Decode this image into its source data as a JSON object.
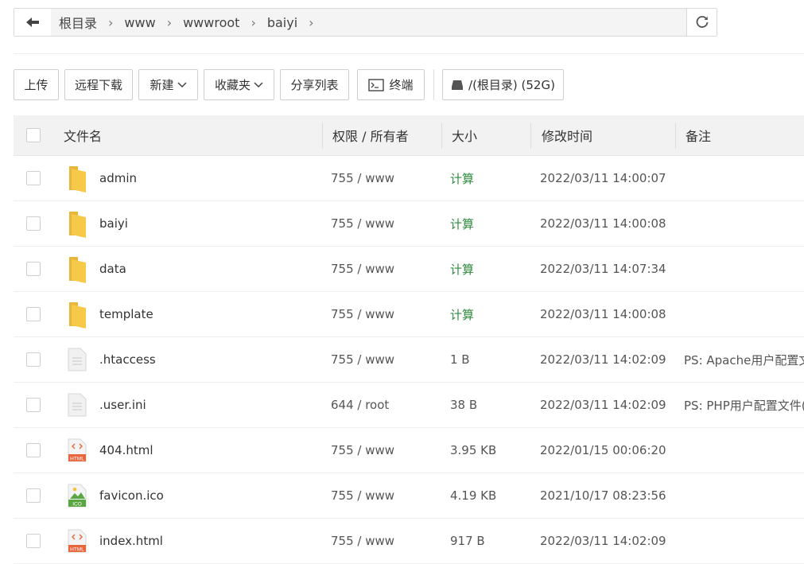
{
  "pathbar": {
    "crumbs": [
      "根目录",
      "www",
      "wwwroot",
      "baiyi"
    ]
  },
  "toolbar": {
    "upload": "上传",
    "remote_download": "远程下载",
    "new": "新建",
    "favorites": "收藏夹",
    "share_list": "分享列表",
    "terminal": "终端",
    "disk": "/(根目录) (52G)"
  },
  "table": {
    "headers": {
      "name": "文件名",
      "perm": "权限 / 所有者",
      "size": "大小",
      "mtime": "修改时间",
      "remark": "备注"
    },
    "rows": [
      {
        "icon": "folder",
        "name": "admin",
        "perm": "755 / www",
        "size": "计算",
        "mtime": "2022/03/11 14:00:07",
        "remark": ""
      },
      {
        "icon": "folder",
        "name": "baiyi",
        "perm": "755 / www",
        "size": "计算",
        "mtime": "2022/03/11 14:00:08",
        "remark": ""
      },
      {
        "icon": "folder",
        "name": "data",
        "perm": "755 / www",
        "size": "计算",
        "mtime": "2022/03/11 14:07:34",
        "remark": ""
      },
      {
        "icon": "folder",
        "name": "template",
        "perm": "755 / www",
        "size": "计算",
        "mtime": "2022/03/11 14:00:08",
        "remark": ""
      },
      {
        "icon": "file",
        "name": ".htaccess",
        "perm": "755 / www",
        "size": "1 B",
        "mtime": "2022/03/11 14:02:09",
        "remark": "PS: Apache用户配置文"
      },
      {
        "icon": "file",
        "name": ".user.ini",
        "perm": "644 / root",
        "size": "38 B",
        "mtime": "2022/03/11 14:02:09",
        "remark": "PS: PHP用户配置文件("
      },
      {
        "icon": "html",
        "name": "404.html",
        "perm": "755 / www",
        "size": "3.95 KB",
        "mtime": "2022/01/15 00:06:20",
        "remark": ""
      },
      {
        "icon": "ico",
        "name": "favicon.ico",
        "perm": "755 / www",
        "size": "4.19 KB",
        "mtime": "2021/10/17 08:23:56",
        "remark": ""
      },
      {
        "icon": "html",
        "name": "index.html",
        "perm": "755 / www",
        "size": "917 B",
        "mtime": "2022/03/11 14:02:09",
        "remark": ""
      }
    ]
  },
  "colors": {
    "folder": "#f7c948",
    "compute_link": "#2e8b3d",
    "html_badge": "#e8663d",
    "ico_badge": "#5aa642"
  },
  "icon_labels": {
    "html": "HTML",
    "ico": "ICO"
  }
}
